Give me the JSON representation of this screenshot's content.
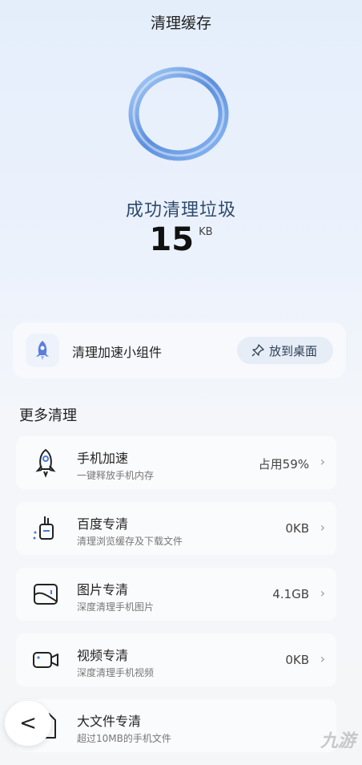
{
  "header": {
    "title": "清理缓存"
  },
  "result": {
    "success_text": "成功清理垃圾",
    "amount": "15",
    "unit": "KB"
  },
  "widget": {
    "label": "清理加速小组件",
    "button_label": "放到桌面"
  },
  "more": {
    "section_title": "更多清理",
    "items": [
      {
        "title": "手机加速",
        "subtitle": "一键释放手机内存",
        "value": "占用59%",
        "icon": "rocket-icon"
      },
      {
        "title": "百度专清",
        "subtitle": "清理浏览缓存及下载文件",
        "value": "0KB",
        "icon": "broom-icon"
      },
      {
        "title": "图片专清",
        "subtitle": "深度清理手机图片",
        "value": "4.1GB",
        "icon": "image-icon"
      },
      {
        "title": "视频专清",
        "subtitle": "深度清理手机视频",
        "value": "0KB",
        "icon": "video-icon"
      },
      {
        "title": "大文件专清",
        "subtitle": "超过10MB的手机文件",
        "value": "",
        "icon": "file-icon"
      }
    ]
  },
  "nav": {
    "back_glyph": "<"
  },
  "watermark": {
    "text": "九游"
  },
  "colors": {
    "accent": "#4a7bd8",
    "ring": "#6f9fe3"
  }
}
